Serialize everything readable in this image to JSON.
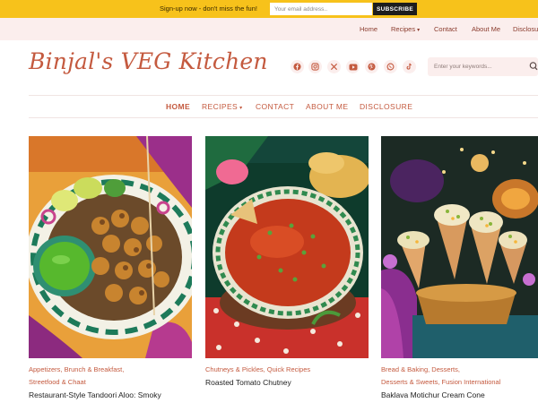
{
  "signup": {
    "text": "Sign-up now - don't miss the fun!",
    "email_placeholder": "Your email address..",
    "button": "SUBSCRIBE"
  },
  "top_nav": {
    "home": "Home",
    "recipes": "Recipes",
    "contact": "Contact",
    "about": "About Me",
    "disclosure": "Disclosure"
  },
  "site": {
    "logo": "Binjal's VEG Kitchen"
  },
  "social_icons": [
    "facebook-icon",
    "instagram-icon",
    "x-icon",
    "youtube-icon",
    "pinterest-icon",
    "whatsapp-icon",
    "tiktok-icon"
  ],
  "search": {
    "placeholder": "Enter your keywords..."
  },
  "main_nav": {
    "home": "HOME",
    "recipes": "RECIPES",
    "contact": "CONTACT",
    "about": "ABOUT ME",
    "disclosure": "DISCLOSURE"
  },
  "cards": [
    {
      "cat1": "Appetizers, Brunch & Breakfast,",
      "cat2": "Streetfood & Chaat",
      "title": "Restaurant-Style Tandoori Aloo: Smoky"
    },
    {
      "cat1": "Chutneys & Pickles, Quick Recipes",
      "title": "Roasted Tomato Chutney"
    },
    {
      "cat1": "Bread & Baking, Desserts,",
      "cat2": "Desserts & Sweets, Fusion International",
      "title": "Baklava Motichur Cream Cone"
    }
  ],
  "colors": {
    "signup_bar": "#f7c21b",
    "accent": "#c45a3f",
    "nav_bg": "#fbeeed"
  }
}
